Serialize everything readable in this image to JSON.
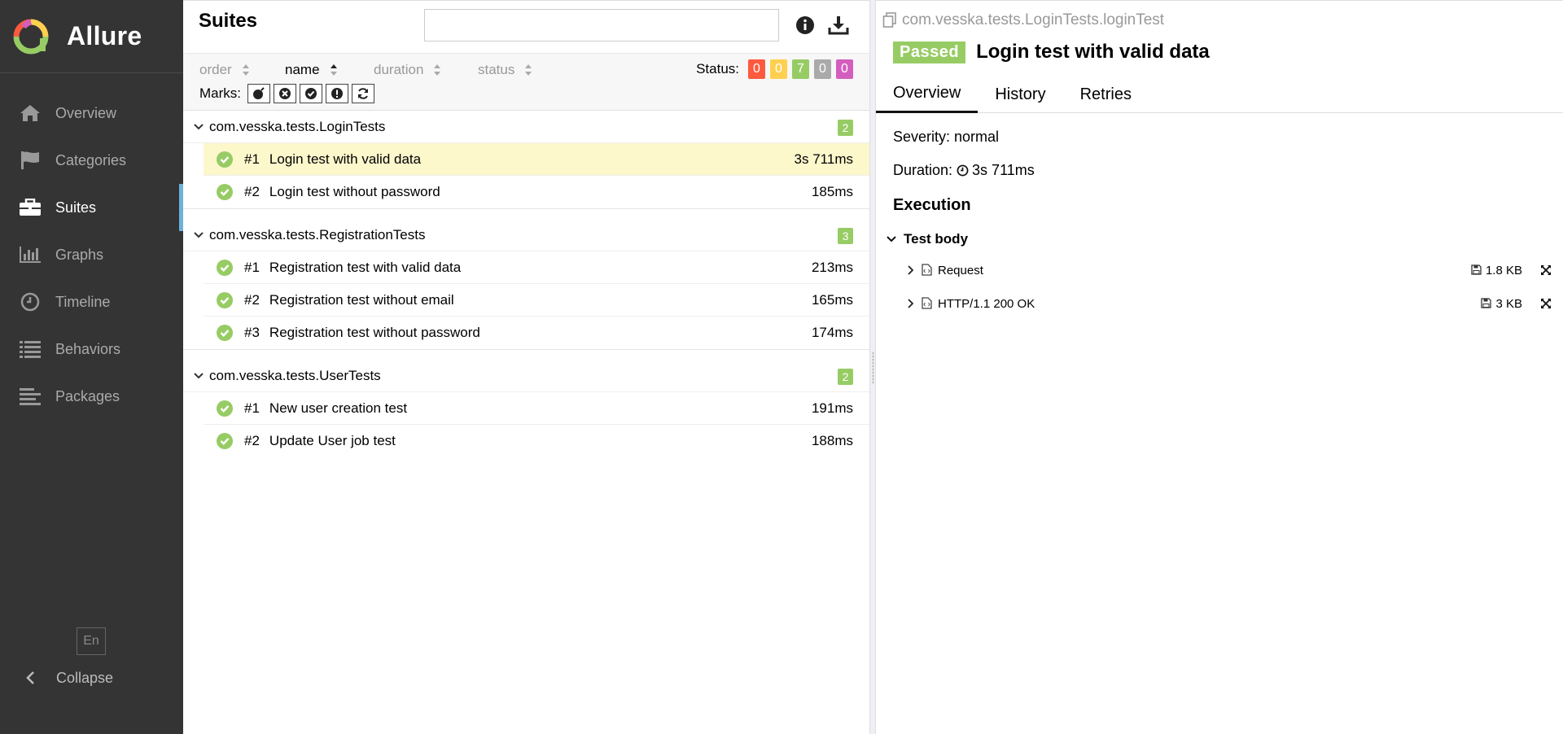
{
  "app": {
    "name": "Allure"
  },
  "sidebar": {
    "items": [
      {
        "label": "Overview",
        "icon": "home-icon"
      },
      {
        "label": "Categories",
        "icon": "flag-icon"
      },
      {
        "label": "Suites",
        "icon": "briefcase-icon",
        "active": true
      },
      {
        "label": "Graphs",
        "icon": "bar-chart-icon"
      },
      {
        "label": "Timeline",
        "icon": "clock-icon"
      },
      {
        "label": "Behaviors",
        "icon": "list-icon"
      },
      {
        "label": "Packages",
        "icon": "align-left-icon"
      }
    ],
    "language": "En",
    "collapse_label": "Collapse"
  },
  "suites": {
    "title": "Suites",
    "search": {
      "value": "",
      "placeholder": ""
    },
    "sorters": [
      "order",
      "name",
      "duration",
      "status"
    ],
    "status_label": "Status:",
    "status_counts": [
      {
        "value": "0",
        "color": "#fd5a3e"
      },
      {
        "value": "0",
        "color": "#ffd050"
      },
      {
        "value": "7",
        "color": "#97cc64"
      },
      {
        "value": "0",
        "color": "#aaaaaa"
      },
      {
        "value": "0",
        "color": "#d35ebe"
      }
    ],
    "marks_label": "Marks:",
    "groups": [
      {
        "name": "com.vesska.tests.LoginTests",
        "count": "2",
        "tests": [
          {
            "num": "#1",
            "name": "Login test with valid data",
            "duration": "3s 711ms",
            "selected": true
          },
          {
            "num": "#2",
            "name": "Login test without password",
            "duration": "185ms"
          }
        ]
      },
      {
        "name": "com.vesska.tests.RegistrationTests",
        "count": "3",
        "tests": [
          {
            "num": "#1",
            "name": "Registration test with valid data",
            "duration": "213ms"
          },
          {
            "num": "#2",
            "name": "Registration test without email",
            "duration": "165ms"
          },
          {
            "num": "#3",
            "name": "Registration test without password",
            "duration": "174ms"
          }
        ]
      },
      {
        "name": "com.vesska.tests.UserTests",
        "count": "2",
        "tests": [
          {
            "num": "#1",
            "name": "New user creation test",
            "duration": "191ms"
          },
          {
            "num": "#2",
            "name": "Update User job test",
            "duration": "188ms"
          }
        ]
      }
    ]
  },
  "detail": {
    "full_name": "com.vesska.tests.LoginTests.loginTest",
    "status": "Passed",
    "title": "Login test with valid data",
    "tabs": [
      "Overview",
      "History",
      "Retries"
    ],
    "severity": "Severity: normal",
    "duration_label": "Duration:",
    "duration_value": "3s 711ms",
    "execution_title": "Execution",
    "test_body_label": "Test body",
    "steps": [
      {
        "name": "Request",
        "size": "1.8 KB"
      },
      {
        "name": "HTTP/1.1 200 OK",
        "size": "3 KB"
      }
    ]
  }
}
